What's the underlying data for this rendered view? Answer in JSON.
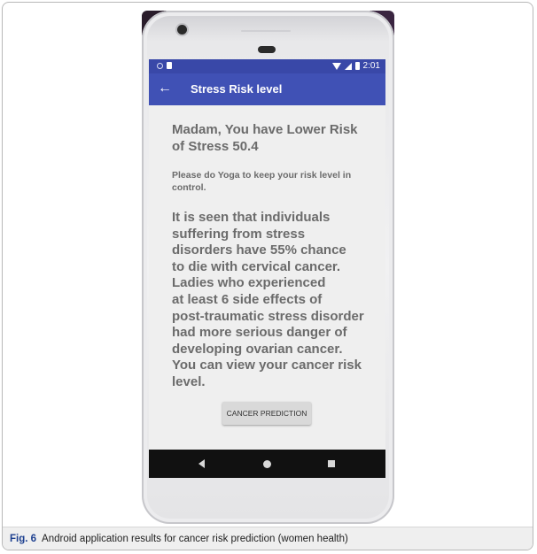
{
  "status_bar": {
    "time": "2:01"
  },
  "app_bar": {
    "back_icon": "←",
    "title": "Stress Risk level"
  },
  "content": {
    "headline": "Madam, You have Lower Risk of Stress 50.4",
    "advice": "Please do Yoga to keep your risk level in control.",
    "info_paragraph": "It is seen that individuals\nsuffering from stress\ndisorders have 55% chance\nto die with cervical cancer.\nLadies who experienced\nat least 6 side effects of\npost-traumatic stress disorder\nhad more serious danger of\ndeveloping ovarian cancer.\nYou can view your cancer risk\nlevel.",
    "button_label": "CANCER PREDICTION"
  },
  "navigation": {
    "back_icon": "nav-back-triangle-icon",
    "home_icon": "nav-home-circle-icon",
    "recent_icon": "nav-recent-square-icon"
  },
  "caption": {
    "label": "Fig. 6",
    "text": "Android application results for cancer risk prediction (women health)"
  },
  "colors": {
    "app_bar": "#4051b5",
    "status_bar": "#3948a8",
    "screen_background": "#efefef",
    "body_text": "#6b6b6b",
    "nav_bar": "#111111",
    "caption_label": "#1c3f8f"
  }
}
